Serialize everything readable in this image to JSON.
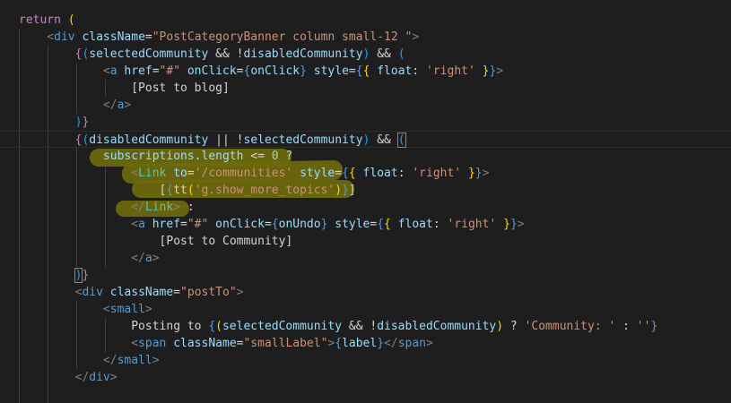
{
  "editor": {
    "lines": [
      "return (",
      "    <div className=\"PostCategoryBanner column small-12 \">",
      "        {(selectedCommunity && !disabledCommunity) && (",
      "            <a href=\"#\" onClick={onClick} style={{ float: 'right' }}>",
      "                [Post to blog]",
      "            </a>",
      "        )}",
      "        {(disabledCommunity || !selectedCommunity) && (",
      "            subscriptions.length <= 0 ?",
      "                <Link to='/communities' style={{ float: 'right' }}>",
      "                    [{tt('g.show_more_topics')}]",
      "                </Link> :",
      "                <a href=\"#\" onClick={onUndo} style={{ float: 'right' }}>",
      "                    [Post to Community]",
      "                </a>",
      "        )}",
      "        <div className=\"postTo\">",
      "            <small>",
      "                Posting to {(selectedCommunity && !disabledCommunity) ? 'Community: ' : ''}",
      "                <span className=\"smallLabel\">{label}</span>",
      "            </small>",
      "        </div>"
    ]
  }
}
